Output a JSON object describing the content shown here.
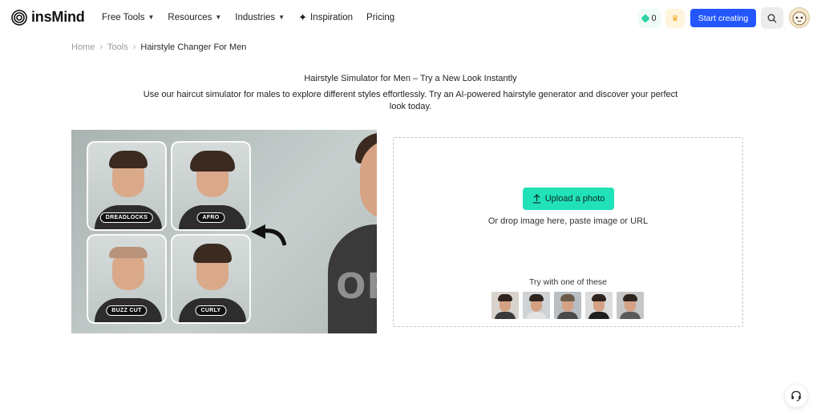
{
  "brand": {
    "name": "insMind"
  },
  "nav": {
    "items": [
      {
        "label": "Free Tools",
        "has_dropdown": true
      },
      {
        "label": "Resources",
        "has_dropdown": true
      },
      {
        "label": "Industries",
        "has_dropdown": true
      },
      {
        "label": "Inspiration",
        "icon": "sparkle-icon"
      },
      {
        "label": "Pricing"
      }
    ]
  },
  "header": {
    "credits": "0",
    "start_label": "Start creating",
    "accent": "#2356ff"
  },
  "breadcrumb": {
    "items": [
      "Home",
      "Tools",
      "Hairstyle Changer For Men"
    ]
  },
  "page": {
    "title": "Hairstyle Simulator for Men – Try a New Look Instantly",
    "subtitle": "Use our haircut simulator for males to explore different styles effortlessly. Try an AI-powered hairstyle generator and discover your perfect look today."
  },
  "hero": {
    "tags": [
      "DREADLOCKS",
      "AFRO",
      "BUZZ CUT",
      "CURLY"
    ],
    "shirt_text": "ORIG"
  },
  "upload": {
    "button_label": "Upload a photo",
    "drop_text": "Or drop image here, paste image or URL",
    "try_text": "Try with one of these",
    "button_color": "#21e1b9"
  }
}
